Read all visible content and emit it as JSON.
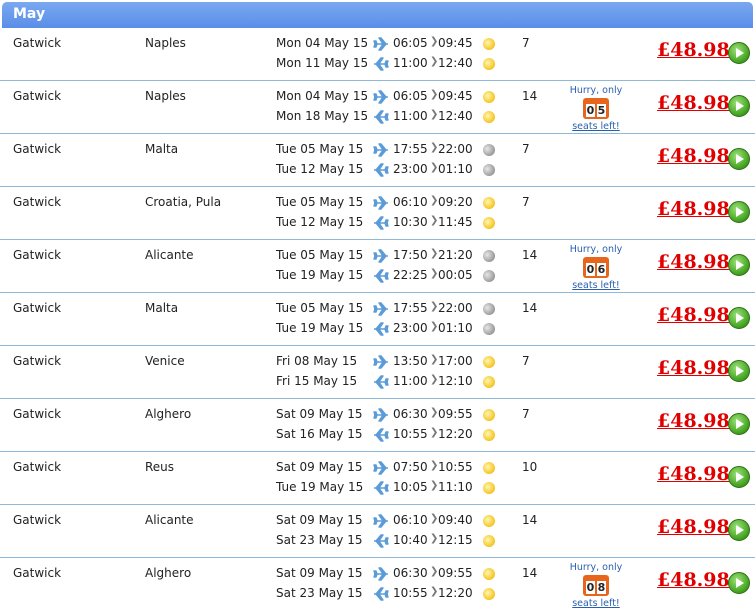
{
  "section": {
    "title": "May"
  },
  "icons": {
    "depart": "plane-right-icon",
    "return": "plane-left-icon",
    "go": "play-circle-icon"
  },
  "colors": {
    "header": "#5a8fe8",
    "price": "#e00000",
    "divider": "#8fb9d9",
    "seats_badge": "#e8651d"
  },
  "hurry_text": {
    "line1": "Hurry, only",
    "line2": "seats left!"
  },
  "rows": [
    {
      "from": "Gatwick",
      "to": "Naples",
      "nights": "7",
      "price": "£48.98",
      "out": {
        "date": "Mon 04 May 15",
        "dep": "06:05",
        "arr": "09:45",
        "tod": "sun"
      },
      "ret": {
        "date": "Mon 11 May 15",
        "dep": "11:00",
        "arr": "12:40",
        "tod": "sun"
      },
      "seats": null
    },
    {
      "from": "Gatwick",
      "to": "Naples",
      "nights": "14",
      "price": "£48.98",
      "out": {
        "date": "Mon 04 May 15",
        "dep": "06:05",
        "arr": "09:45",
        "tod": "sun"
      },
      "ret": {
        "date": "Mon 18 May 15",
        "dep": "11:00",
        "arr": "12:40",
        "tod": "sun"
      },
      "seats": [
        "0",
        "5"
      ]
    },
    {
      "from": "Gatwick",
      "to": "Malta",
      "nights": "7",
      "price": "£48.98",
      "out": {
        "date": "Tue 05 May 15",
        "dep": "17:55",
        "arr": "22:00",
        "tod": "moon"
      },
      "ret": {
        "date": "Tue 12 May 15",
        "dep": "23:00",
        "arr": "01:10",
        "tod": "moon"
      },
      "seats": null
    },
    {
      "from": "Gatwick",
      "to": "Croatia, Pula",
      "nights": "7",
      "price": "£48.98",
      "out": {
        "date": "Tue 05 May 15",
        "dep": "06:10",
        "arr": "09:20",
        "tod": "sun"
      },
      "ret": {
        "date": "Tue 12 May 15",
        "dep": "10:30",
        "arr": "11:45",
        "tod": "sun"
      },
      "seats": null
    },
    {
      "from": "Gatwick",
      "to": "Alicante",
      "nights": "14",
      "price": "£48.98",
      "out": {
        "date": "Tue 05 May 15",
        "dep": "17:50",
        "arr": "21:20",
        "tod": "moon"
      },
      "ret": {
        "date": "Tue 19 May 15",
        "dep": "22:25",
        "arr": "00:05",
        "tod": "moon"
      },
      "seats": [
        "0",
        "6"
      ]
    },
    {
      "from": "Gatwick",
      "to": "Malta",
      "nights": "14",
      "price": "£48.98",
      "out": {
        "date": "Tue 05 May 15",
        "dep": "17:55",
        "arr": "22:00",
        "tod": "moon"
      },
      "ret": {
        "date": "Tue 19 May 15",
        "dep": "23:00",
        "arr": "01:10",
        "tod": "moon"
      },
      "seats": null
    },
    {
      "from": "Gatwick",
      "to": "Venice",
      "nights": "7",
      "price": "£48.98",
      "out": {
        "date": "Fri 08 May 15",
        "dep": "13:50",
        "arr": "17:00",
        "tod": "sun"
      },
      "ret": {
        "date": "Fri 15 May 15",
        "dep": "11:00",
        "arr": "12:10",
        "tod": "sun"
      },
      "seats": null
    },
    {
      "from": "Gatwick",
      "to": "Alghero",
      "nights": "7",
      "price": "£48.98",
      "out": {
        "date": "Sat 09 May 15",
        "dep": "06:30",
        "arr": "09:55",
        "tod": "sun"
      },
      "ret": {
        "date": "Sat 16 May 15",
        "dep": "10:55",
        "arr": "12:20",
        "tod": "sun"
      },
      "seats": null
    },
    {
      "from": "Gatwick",
      "to": "Reus",
      "nights": "10",
      "price": "£48.98",
      "out": {
        "date": "Sat 09 May 15",
        "dep": "07:50",
        "arr": "10:55",
        "tod": "sun"
      },
      "ret": {
        "date": "Tue 19 May 15",
        "dep": "10:05",
        "arr": "11:10",
        "tod": "sun"
      },
      "seats": null
    },
    {
      "from": "Gatwick",
      "to": "Alicante",
      "nights": "14",
      "price": "£48.98",
      "out": {
        "date": "Sat 09 May 15",
        "dep": "06:10",
        "arr": "09:40",
        "tod": "sun"
      },
      "ret": {
        "date": "Sat 23 May 15",
        "dep": "10:40",
        "arr": "12:15",
        "tod": "sun"
      },
      "seats": null
    },
    {
      "from": "Gatwick",
      "to": "Alghero",
      "nights": "14",
      "price": "£48.98",
      "out": {
        "date": "Sat 09 May 15",
        "dep": "06:30",
        "arr": "09:55",
        "tod": "sun"
      },
      "ret": {
        "date": "Sat 23 May 15",
        "dep": "10:55",
        "arr": "12:20",
        "tod": "sun"
      },
      "seats": [
        "0",
        "8"
      ]
    }
  ]
}
